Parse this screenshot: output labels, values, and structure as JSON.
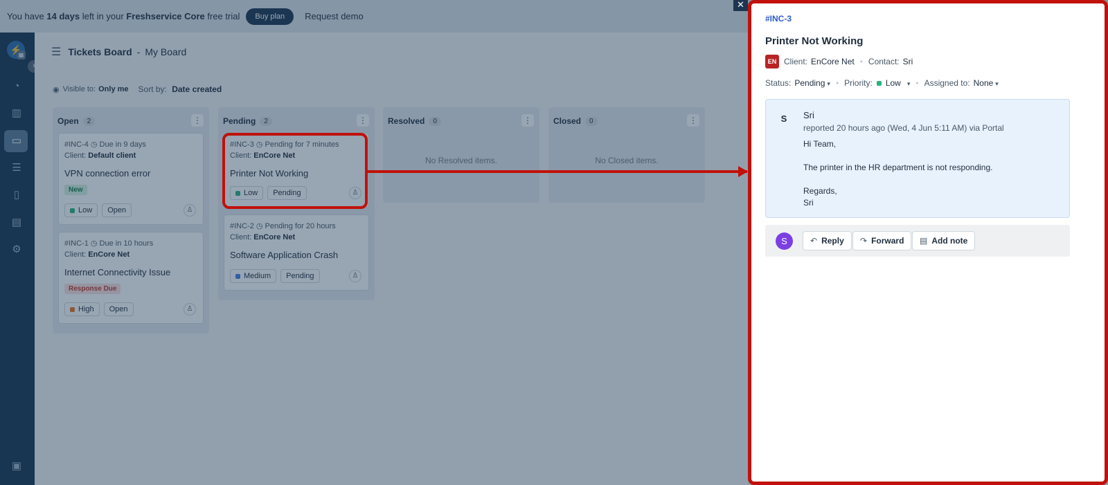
{
  "banner": {
    "text_before": "You have",
    "days": "14 days",
    "text_middle": "left in your",
    "product": "Freshservice Core",
    "text_after": "free trial",
    "buy_label": "Buy plan",
    "demo_label": "Request demo"
  },
  "sidebar": {
    "logo": "⚡",
    "toggle": "›",
    "icons": [
      "dashboard-icon",
      "building-icon",
      "tickets-icon",
      "checklist-icon",
      "book-icon",
      "reports-icon",
      "settings-icon",
      "panel-icon"
    ]
  },
  "header": {
    "title": "Tickets Board",
    "separator": "-",
    "board": "My Board",
    "visible_label": "Visible to:",
    "visible_value": "Only me",
    "sort_label": "Sort by:",
    "sort_value": "Date created"
  },
  "columns": [
    {
      "name": "Open",
      "count": "2",
      "empty": ""
    },
    {
      "name": "Pending",
      "count": "2",
      "empty": ""
    },
    {
      "name": "Resolved",
      "count": "0",
      "empty": "No Resolved items."
    },
    {
      "name": "Closed",
      "count": "0",
      "empty": "No Closed items."
    }
  ],
  "cards": {
    "inc4": {
      "meta": "#INC-4 ◷ Due in 9 days",
      "client_label": "Client:",
      "client": "Default client",
      "subject": "VPN connection error",
      "status_tag": "New",
      "priority": "Low",
      "priority_color": "#29b37e",
      "state": "Open"
    },
    "inc1": {
      "meta": "#INC-1 ◷ Due in 10 hours",
      "client_label": "Client:",
      "client": "EnCore Net",
      "subject": "Internet Connectivity Issue",
      "status_tag": "Response Due",
      "priority": "High",
      "priority_color": "#e8742a",
      "state": "Open"
    },
    "inc3": {
      "meta": "#INC-3 ◷ Pending for 7 minutes",
      "client_label": "Client:",
      "client": "EnCore Net",
      "subject": "Printer Not Working",
      "priority": "Low",
      "priority_color": "#29b37e",
      "state": "Pending"
    },
    "inc2": {
      "meta": "#INC-2 ◷ Pending for 20 hours",
      "client_label": "Client:",
      "client": "EnCore Net",
      "subject": "Software Application Crash",
      "priority": "Medium",
      "priority_color": "#3b82e8",
      "state": "Pending"
    }
  },
  "detail": {
    "close": "✕",
    "id": "#INC-3",
    "title": "Printer Not Working",
    "client_badge": "EN",
    "client_label": "Client:",
    "client": "EnCore Net",
    "contact_label": "Contact:",
    "contact": "Sri",
    "status_label": "Status:",
    "status": "Pending",
    "priority_label": "Priority:",
    "priority": "Low",
    "assigned_label": "Assigned to:",
    "assigned": "None",
    "message": {
      "avatar": "S",
      "sender": "Sri",
      "reported": "reported 20 hours ago (Wed, 4 Jun 5:11 AM) via Portal",
      "line1": "Hi Team,",
      "line2": "The printer in the HR department is not responding.",
      "line3": "Regards,",
      "line4": "Sri"
    },
    "reply_avatar": "S",
    "reply_label": "Reply",
    "forward_label": "Forward",
    "note_label": "Add note"
  }
}
